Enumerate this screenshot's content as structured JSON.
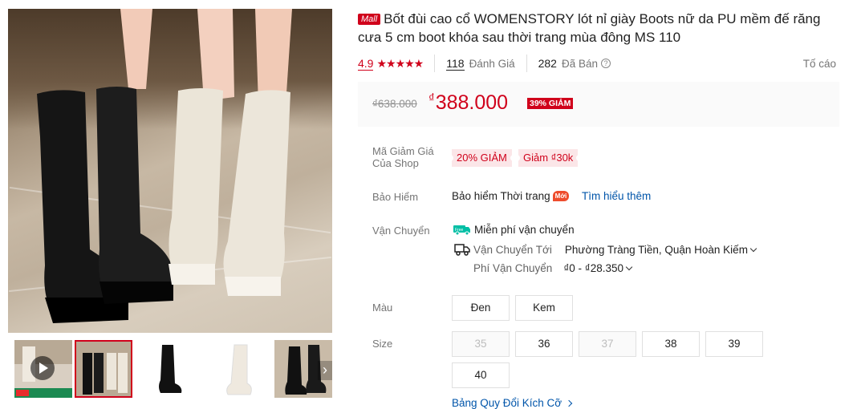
{
  "product": {
    "mall_badge": "Mall",
    "title": "Bốt đùi cao cổ WOMENSTORY lót nỉ giày Boots nữ da PU mềm đế răng cưa 5 cm boot khóa sau thời trang mùa đông MS 110"
  },
  "stats": {
    "rating": "4.9",
    "stars": "★★★★★",
    "reviews_count": "118",
    "reviews_label": "Đánh Giá",
    "sold_count": "282",
    "sold_label": "Đã Bán",
    "report_label": "Tố cáo"
  },
  "price": {
    "original": "₫638.000",
    "currency": "₫",
    "current": "388.000",
    "discount": "39% GIẢM"
  },
  "vouchers": {
    "label": "Mã Giảm Giá Của Shop",
    "items": [
      "20% GIẢM",
      "Giảm ₫30k"
    ]
  },
  "insurance": {
    "label": "Bảo Hiểm",
    "text": "Bảo hiểm Thời trang",
    "badge": "Mới",
    "link": "Tìm hiểu thêm"
  },
  "shipping": {
    "label": "Vận Chuyển",
    "free_text": "Miễn phí vận chuyển",
    "free_icon_text": "Free",
    "to_label": "Vận Chuyển Tới",
    "to_value": "Phường Tràng Tiền, Quận Hoàn Kiếm",
    "fee_label": "Phí Vận Chuyển",
    "fee_value": "₫0 - ₫28.350"
  },
  "color": {
    "label": "Màu",
    "options": [
      "Đen",
      "Kem"
    ]
  },
  "size": {
    "label": "Size",
    "options": [
      "35",
      "36",
      "37",
      "38",
      "39",
      "40"
    ],
    "disabled": [
      "35",
      "37"
    ],
    "guide": "Bảng Quy Đổi Kích Cỡ"
  },
  "colors": {
    "accent": "#d0011b",
    "link": "#0055aa"
  },
  "icons": [
    "play-icon",
    "chevron-right-icon",
    "star-icon",
    "help-icon",
    "freeship-icon",
    "truck-icon",
    "chevron-down-icon"
  ]
}
